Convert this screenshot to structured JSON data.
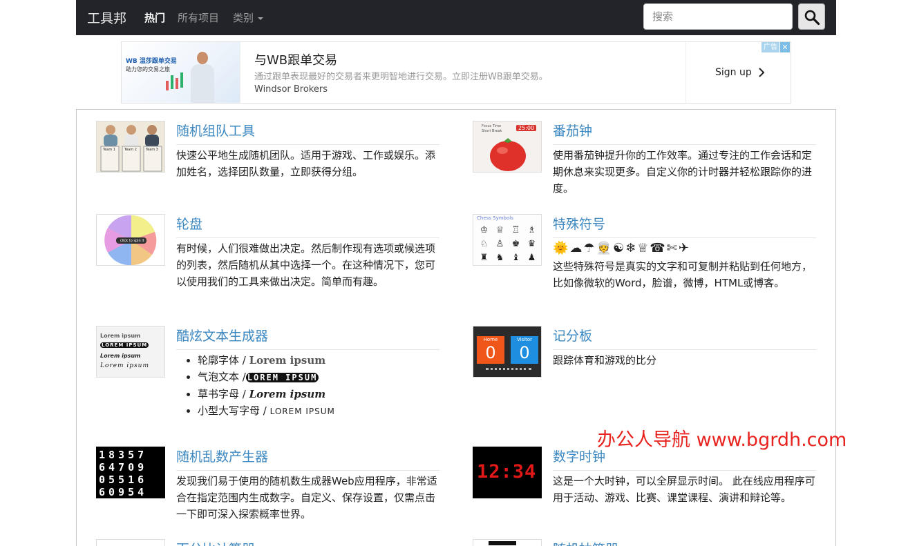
{
  "navbar": {
    "brand": "工具邦",
    "items": [
      {
        "label": "热门",
        "active": true
      },
      {
        "label": "所有项目",
        "active": false
      },
      {
        "label": "类别",
        "active": false,
        "dropdown": true
      }
    ],
    "search_placeholder": "搜索",
    "search_icon": "magnifier-icon"
  },
  "ad": {
    "title": "与WB跟单交易",
    "description": "通过跟单表现最好的交易者来更明智地进行交易。立即注册WB跟单交易。",
    "source": "Windsor Brokers",
    "cta": "Sign up",
    "badge": "广告",
    "close": "✕",
    "image_logo": "WB 温莎跟单交易",
    "image_tagline": "助力您的交易之旅"
  },
  "cards": [
    {
      "title": "随机组队工具",
      "description": "快速公平地生成随机团队。适用于游戏、工作或娱乐。添加姓名，选择团队数量，立即获得分组。",
      "thumb": {
        "labels": [
          "Team 1",
          "Team 2",
          "Team 3"
        ]
      }
    },
    {
      "title": "番茄钟",
      "description": "使用番茄钟提升你的工作效率。通过专注的工作会话和定期休息来实现更多。自定义你的计时器并轻松跟踪你的进度。",
      "thumb": {
        "line1": "Focus Time",
        "line2": "Short Break",
        "time": "25:00"
      }
    },
    {
      "title": "轮盘",
      "description": "有时候，人们很难做出决定。然后制作现有选项或候选项的列表，然后随机从其中选择一个。在这种情况下，您可以使用我们的工具来做出决定。简单而有趣。",
      "thumb": {
        "button": "click to spin it"
      }
    },
    {
      "title": "特殊符号",
      "symbols": "🌞☁☂👳☯❄♕☎✄✈",
      "description": "这些特殊符号是真实的文字和可复制并粘贴到任何地方，比如像微软的Word，脸谱，微博，HTML或博客。",
      "thumb": {
        "title": "Chess Symbols",
        "glyphs": [
          "♔",
          "♕",
          "♖",
          "♗",
          "♘",
          "♙",
          "♚",
          "♛",
          "♜",
          "♞",
          "♝",
          "♟"
        ]
      }
    },
    {
      "title": "酷炫文本生成器",
      "list": [
        {
          "label": "轮廓字体 / ",
          "sample": "Lorem ipsum"
        },
        {
          "label": "气泡文本 /",
          "sample": "LOREM IPSUM"
        },
        {
          "label": "草书字母 / ",
          "sample": "Lorem ipsum"
        },
        {
          "label": "小型大写字母 / ",
          "sample": "LOREM IPSUM"
        }
      ],
      "thumb": {
        "lines": [
          "Lorem ipsum",
          "LOREM IPSUM",
          "Lorem ipsum",
          "Lorem ipsum"
        ]
      }
    },
    {
      "title": "记分板",
      "description": "跟踪体育和游戏的比分",
      "thumb": {
        "home": "Home",
        "visitor": "Visitor",
        "home_score": "0",
        "visitor_score": "0"
      }
    },
    {
      "title": "随机乱数产生器",
      "description": "发现我们易于使用的随机数生成器Web应用程序，非常适合在指定范围内生成数字。自定义、保存设置，仅需点击一下即可深入探索概率世界。",
      "thumb": {
        "rows": [
          "18357",
          "64709",
          "05516",
          "60954"
        ]
      }
    },
    {
      "title": "数字时钟",
      "description": "这是一个大时钟，可以全屏显示时间。 此在线应用程序可用于活动、游戏、比赛、课堂课程、演讲和辩论等。",
      "thumb": {
        "time": "12:34"
      }
    },
    {
      "title": "百分比计算器"
    },
    {
      "title": "随机抽签器"
    }
  ],
  "watermark": "办公人导航  www.bgrdh.com",
  "colors": {
    "navbar": "#222429",
    "link": "#3b87c0",
    "watermark": "#e8231f"
  }
}
